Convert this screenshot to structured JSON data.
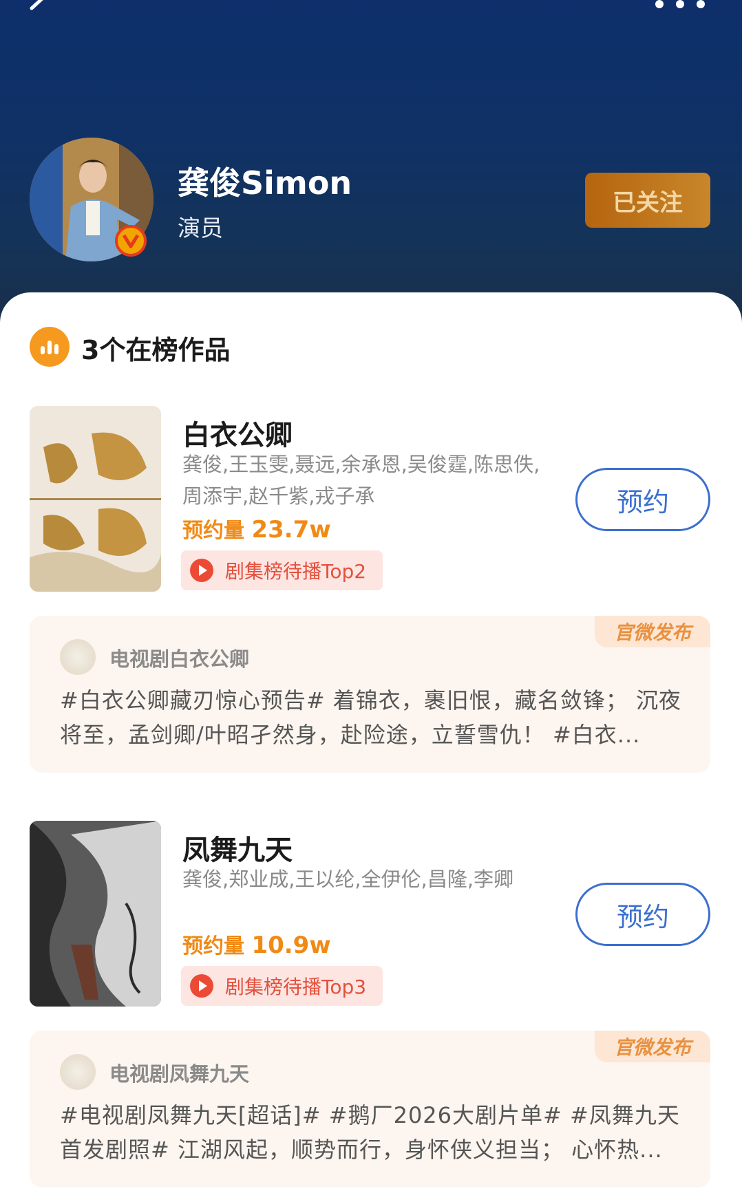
{
  "profile": {
    "name": "龚俊Simon",
    "role": "演员",
    "follow_label": "已关注"
  },
  "section": {
    "title": "3个在榜作品"
  },
  "dramas": [
    {
      "title": "白衣公卿",
      "cast_line1": "龚俊,王玉雯,聂远,余承恩,吴俊霆,陈思佚,",
      "cast_line2": "周添宇,赵千紫,戎子承",
      "reserve_label": "预约量",
      "reserve_value": "23.7w",
      "rank_tag": "剧集榜待播Top2",
      "reserve_button": "预约",
      "post": {
        "badge": "官微发布",
        "account": "电视剧白衣公卿",
        "text": "#白衣公卿藏刃惊心预告# 着锦衣，裹旧恨，藏名敛锋； 沉夜将至，孟剑卿/叶昭孑然身，赴险途，立誓雪仇！ #白衣..."
      }
    },
    {
      "title": "凤舞九天",
      "cast_line1": "龚俊,郑业成,王以纶,全伊伦,昌隆,李卿",
      "cast_line2": "",
      "reserve_label": "预约量",
      "reserve_value": "10.9w",
      "rank_tag": "剧集榜待播Top3",
      "reserve_button": "预约",
      "post": {
        "badge": "官微发布",
        "account": "电视剧凤舞九天",
        "text": "#电视剧凤舞九天[超话]# #鹅厂2026大剧片单# #凤舞九天首发剧照# 江湖风起，顺势而行，身怀侠义担当； 心怀热..."
      }
    }
  ],
  "icons": {
    "back": "back-arrow-icon",
    "more": "more-dots-icon",
    "verified": "verified-v-icon",
    "chart": "bar-chart-icon",
    "play": "play-icon"
  },
  "colors": {
    "accent_blue": "#3b6fd0",
    "reserve_orange": "#f08a15",
    "rank_red": "#e4503c",
    "follow_gold": "#c9862a"
  }
}
